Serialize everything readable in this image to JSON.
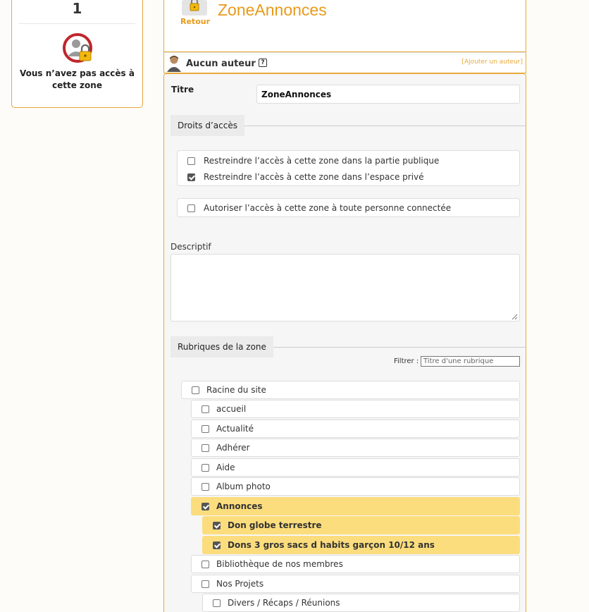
{
  "left_panel": {
    "count": "1",
    "message": "Vous n’avez pas accès à cette zone",
    "icon": "no-access-lock-icon"
  },
  "header": {
    "back_label": "Retour",
    "zone_title": "ZoneAnnonces"
  },
  "author": {
    "label": "Aucun auteur",
    "help": "?",
    "add_link": "[Ajouter un auteur]"
  },
  "form": {
    "titre_label": "Titre",
    "titre_value": "ZoneAnnonces",
    "droits_legend": "Droits d’accès",
    "options": [
      {
        "label": "Restreindre l’accès à cette zone dans la partie publique",
        "checked": false
      },
      {
        "label": "Restreindre l’accès à cette zone dans l’espace privé",
        "checked": true
      },
      {
        "label": "Autoriser l’accès à cette zone à toute personne connectée",
        "checked": false
      }
    ],
    "descriptif_label": "Descriptif",
    "descriptif_value": "",
    "rubriques_legend": "Rubriques de la zone",
    "filter_label": "Filtrer :",
    "filter_placeholder": "Titre d'une rubrique"
  },
  "tree": [
    {
      "label": "Racine du site",
      "level": 0,
      "checked": false,
      "selected": false
    },
    {
      "label": "accueil",
      "level": 1,
      "checked": false,
      "selected": false
    },
    {
      "label": "Actualité",
      "level": 1,
      "checked": false,
      "selected": false
    },
    {
      "label": "Adhérer",
      "level": 1,
      "checked": false,
      "selected": false
    },
    {
      "label": "Aide",
      "level": 1,
      "checked": false,
      "selected": false
    },
    {
      "label": "Album photo",
      "level": 1,
      "checked": false,
      "selected": false
    },
    {
      "label": "Annonces",
      "level": 1,
      "checked": true,
      "selected": true
    },
    {
      "label": "Don globe terrestre",
      "level": 2,
      "checked": true,
      "selected": true
    },
    {
      "label": "Dons 3 gros sacs d habits garçon 10/12 ans",
      "level": 2,
      "checked": true,
      "selected": true
    },
    {
      "label": "Bibliothèque de nos membres",
      "level": 1,
      "checked": false,
      "selected": false
    },
    {
      "label": "Nos Projets",
      "level": 1,
      "checked": false,
      "selected": false
    },
    {
      "label": "Divers / Récaps / Réunions",
      "level": 2,
      "checked": false,
      "selected": false
    }
  ]
}
